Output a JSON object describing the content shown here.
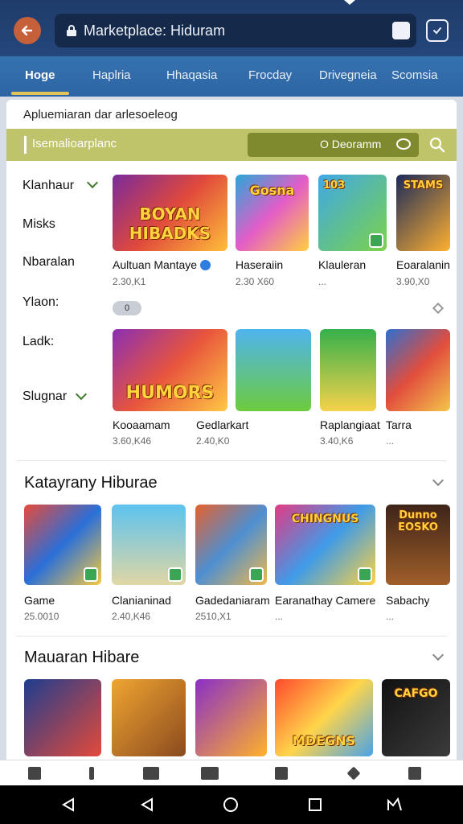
{
  "topbar": {
    "url": "Marketplace: Hiduram",
    "icons": {
      "back": "back-arrow-icon",
      "lock": "lock-icon",
      "tab": "tab-switch-icon",
      "shield": "shield-check-icon"
    }
  },
  "tabs": [
    "Hoge",
    "Haplria",
    "Hhaqasia",
    "Frocday",
    "Drivegneia",
    "Scomsia"
  ],
  "app_description": "Apluemiaran dar arlesoeleog",
  "filter": {
    "label": "Isemalioarplanc",
    "box_label": "O Deoramm",
    "box_icon": "toggle-icon",
    "search_icon": "search-icon"
  },
  "categories": [
    "Klanhaur",
    "Misks",
    "Nbaralan",
    "Ylaon:",
    "Ladk:",
    "Slugnar"
  ],
  "row1": [
    {
      "art": "BOYAN HIBADKS",
      "title": "Aultuan Mantaye",
      "meta": "2.30,K1",
      "verified": true
    },
    {
      "art": "Gosna",
      "title": "Haseraiin",
      "meta": "2.30 X60"
    },
    {
      "art": "103",
      "title": "Klauleran",
      "meta": "..."
    },
    {
      "art": "STAMS",
      "title": "Eoaralanin",
      "meta": "3.90,X0"
    }
  ],
  "chip": "0",
  "row2": [
    {
      "art": "HUMORS",
      "title": "Kooaamam",
      "meta": "3.60,K46"
    },
    {
      "art": "",
      "title": "Gedlarkart",
      "meta": "2.40,K0"
    },
    {
      "art": "",
      "title": "Raplangiaat",
      "meta": "3.40,K6"
    },
    {
      "art": "",
      "title": "Tarra",
      "meta": "..."
    }
  ],
  "sections": [
    {
      "title": "Katayrany Hiburae",
      "games": [
        {
          "art": "",
          "title": "Game",
          "meta": "25.0010"
        },
        {
          "art": "",
          "title": "Clanianinad",
          "meta": "2.40,K46"
        },
        {
          "art": "",
          "title": "Gadedaniaram",
          "meta": "2510,X1"
        },
        {
          "art": "CHINGNUS",
          "title": "Earanathay Camere",
          "meta": "..."
        },
        {
          "art": "Dunno EOSKO",
          "title": "Sabachy",
          "meta": "..."
        }
      ]
    },
    {
      "title": "Mauaran Hibare",
      "games": [
        {
          "art": "",
          "title": "",
          "meta": ""
        },
        {
          "art": "",
          "title": "",
          "meta": ""
        },
        {
          "art": "",
          "title": "",
          "meta": ""
        },
        {
          "art": "MDEGNS",
          "title": "",
          "meta": ""
        },
        {
          "art": "CAFGO",
          "title": "",
          "meta": ""
        }
      ]
    }
  ],
  "appnav_icons": [
    "home-icon",
    "phone-icon",
    "store-icon",
    "edit-icon",
    "archive-icon",
    "star-icon",
    "download-icon"
  ],
  "sysnav_icons": [
    "back-triangle-icon",
    "back-triangle-icon",
    "home-circle-icon",
    "recents-square-icon",
    "keyboard-icon"
  ],
  "colors": {
    "topbar": "#1f3c6b",
    "tabbar": "#3672b0",
    "filterbar": "#bfc36a",
    "accent": "#e3c35a"
  }
}
